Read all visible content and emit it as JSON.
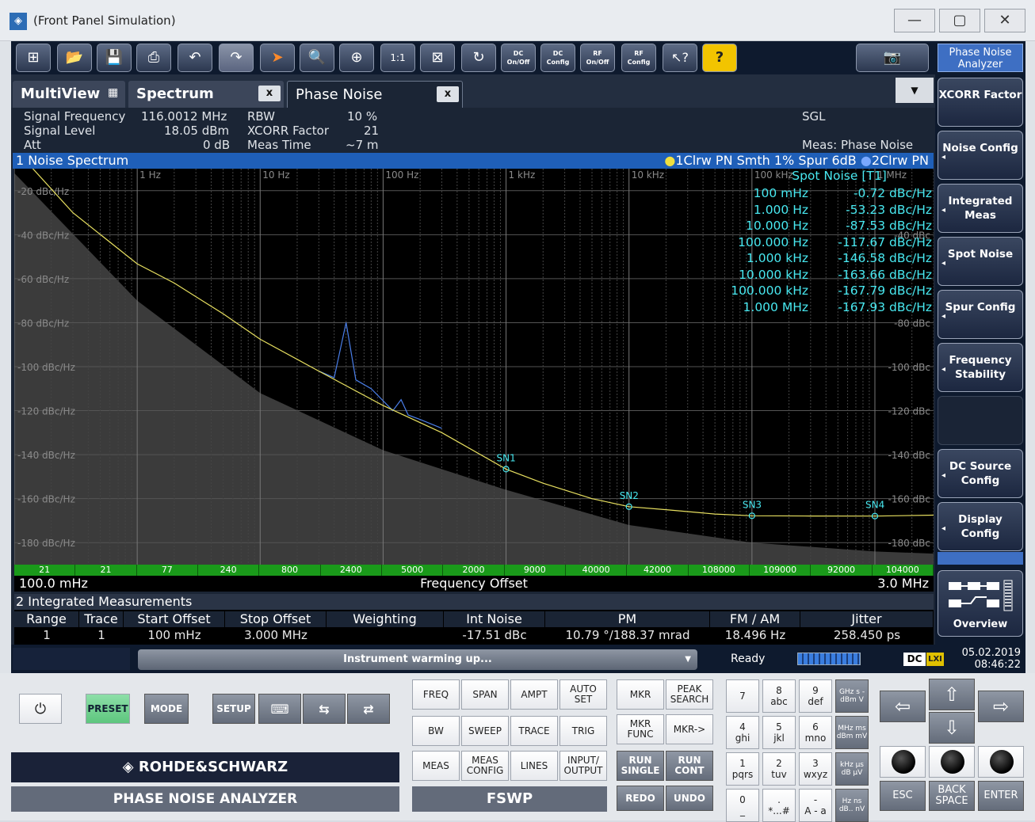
{
  "window": {
    "title": "(Front Panel Simulation)",
    "minimize": "—",
    "maximize": "▢",
    "close": "✕"
  },
  "toolbar": {
    "dc_onoff": "DC On/Off",
    "dc_config": "DC Config",
    "rf_onoff": "RF On/Off",
    "rf_config": "RF Config",
    "help": "?"
  },
  "softkeys": {
    "title": "Phase Noise Analyzer",
    "items": [
      "XCORR Factor",
      "Noise Config",
      "Integrated Meas",
      "Spot Noise",
      "Spur Config",
      "Frequency Stability",
      "",
      "DC Source Config",
      "Display Config"
    ],
    "overview": "Overview"
  },
  "tabs": {
    "multiview": "MultiView",
    "spectrum": "Spectrum",
    "phase_noise": "Phase Noise",
    "close_label": "x",
    "dropdown": "▼"
  },
  "info": {
    "signal_frequency_label": "Signal Frequency",
    "signal_frequency_value": "116.0012 MHz",
    "signal_level_label": "Signal Level",
    "signal_level_value": "18.05 dBm",
    "att_label": "Att",
    "att_value": "0 dB",
    "rbw_label": "RBW",
    "rbw_value": "10 %",
    "xcorr_label": "XCORR Factor",
    "xcorr_value": "21",
    "meas_time_label": "Meas Time",
    "meas_time_value": "~7 m",
    "sgl": "SGL",
    "meas": "Meas: Phase Noise"
  },
  "window1": {
    "title": "1 Noise Spectrum",
    "trace1": "1Clrw PN Smth 1% Spur 6dB",
    "trace2": "2Clrw PN"
  },
  "spot_noise": {
    "title": "Spot Noise [T1]",
    "rows": [
      {
        "freq": "100 mHz",
        "value": "-0.72 dBc/Hz"
      },
      {
        "freq": "1.000 Hz",
        "value": "-53.23 dBc/Hz"
      },
      {
        "freq": "10.000 Hz",
        "value": "-87.53 dBc/Hz"
      },
      {
        "freq": "100.000 Hz",
        "value": "-117.67 dBc/Hz"
      },
      {
        "freq": "1.000 kHz",
        "value": "-146.58 dBc/Hz"
      },
      {
        "freq": "10.000 kHz",
        "value": "-163.66 dBc/Hz"
      },
      {
        "freq": "100.000 kHz",
        "value": "-167.79 dBc/Hz"
      },
      {
        "freq": "1.000 MHz",
        "value": "-167.93 dBc/Hz"
      }
    ]
  },
  "chart_data": {
    "type": "line",
    "x_scale": "log",
    "xlim": [
      0.1,
      3000000
    ],
    "ylim": [
      -190,
      -10
    ],
    "x_ticks": [
      {
        "x": 1,
        "label": "1 Hz"
      },
      {
        "x": 10,
        "label": "10 Hz"
      },
      {
        "x": 100,
        "label": "100 Hz"
      },
      {
        "x": 1000,
        "label": "1 kHz"
      },
      {
        "x": 10000,
        "label": "10 kHz"
      },
      {
        "x": 100000,
        "label": "100 kHz"
      },
      {
        "x": 1000000,
        "label": "1 MHz"
      }
    ],
    "y_ticks_left": [
      {
        "y": -20,
        "label": "-20 dBc/Hz"
      },
      {
        "y": -40,
        "label": "-40 dBc/Hz"
      },
      {
        "y": -60,
        "label": "-60 dBc/Hz"
      },
      {
        "y": -80,
        "label": "-80 dBc/Hz"
      },
      {
        "y": -100,
        "label": "-100 dBc/Hz"
      },
      {
        "y": -120,
        "label": "-120 dBc/Hz"
      },
      {
        "y": -140,
        "label": "-140 dBc/Hz"
      },
      {
        "y": -160,
        "label": "-160 dBc/Hz"
      },
      {
        "y": -180,
        "label": "-180 dBc/Hz"
      }
    ],
    "y_ticks_right": [
      {
        "y": -40,
        "label": "-40 dBc"
      },
      {
        "y": -80,
        "label": "-80 dBc"
      },
      {
        "y": -100,
        "label": "-100 dBc"
      },
      {
        "y": -120,
        "label": "-120 dBc"
      },
      {
        "y": -140,
        "label": "-140 dBc"
      },
      {
        "y": -160,
        "label": "-160 dBc"
      },
      {
        "y": -180,
        "label": "-180 dBc"
      }
    ],
    "series": [
      {
        "name": "1Clrw PN Smth 1% Spur 6dB",
        "color": "#e8e060",
        "x": [
          0.1,
          0.3,
          1,
          2,
          5,
          10,
          30,
          100,
          300,
          1000,
          2000,
          5000,
          10000,
          20000,
          50000,
          100000,
          300000,
          1000000,
          3000000
        ],
        "y": [
          -0.72,
          -30,
          -53.23,
          -62,
          -76,
          -87.53,
          -102,
          -117.67,
          -130,
          -146.58,
          -153,
          -160,
          -163.66,
          -165,
          -167,
          -167.79,
          -167.9,
          -167.93,
          -167.5
        ]
      },
      {
        "name": "2Clrw PN",
        "color": "#4a7ee8",
        "x": [
          30,
          40,
          50,
          60,
          80,
          120,
          140,
          160,
          200,
          300
        ],
        "y": [
          -102,
          -105,
          -80,
          -106,
          -110,
          -120,
          -115,
          -122,
          -124,
          -128
        ]
      }
    ],
    "noise_floor": {
      "color": "#3b3b3b",
      "x": [
        0.1,
        1,
        10,
        100,
        1000,
        10000,
        100000,
        1000000,
        3000000
      ],
      "y": [
        -12,
        -70,
        -112,
        -138,
        -156,
        -172,
        -180,
        -184,
        -185
      ]
    },
    "markers": [
      {
        "label": "SN1",
        "x": 1000,
        "y": -146.58
      },
      {
        "label": "SN2",
        "x": 10000,
        "y": -163.66
      },
      {
        "label": "SN3",
        "x": 100000,
        "y": -167.79
      },
      {
        "label": "SN4",
        "x": 1000000,
        "y": -167.93
      }
    ],
    "xcorr_bar": [
      "21",
      "21",
      "77",
      "240",
      "800",
      "2400",
      "5000",
      "2000",
      "9000",
      "40000",
      "42000",
      "108000",
      "109000",
      "92000",
      "104000"
    ],
    "x_start": "100.0 mHz",
    "x_label": "Frequency Offset",
    "x_stop": "3.0 MHz"
  },
  "window2": {
    "title": "2 Integrated Measurements",
    "headers": [
      "Range",
      "Trace",
      "Start Offset",
      "Stop Offset",
      "Weighting",
      "Int Noise",
      "PM",
      "FM / AM",
      "Jitter"
    ],
    "row": [
      "1",
      "1",
      "100 mHz",
      "3.000 MHz",
      "",
      "-17.51 dBc",
      "10.79 °/188.37 mrad",
      "18.496 Hz",
      "258.450 ps"
    ]
  },
  "status": {
    "message": "Instrument warming up...",
    "ready": "Ready",
    "dc": "DC",
    "lxi": "LXI",
    "date": "05.02.2019",
    "time": "08:46:22"
  },
  "front": {
    "power": "⏻",
    "preset": "PRESET",
    "mode": "MODE",
    "setup": "SETUP",
    "brand": "ROHDE&SCHWARZ",
    "product": "PHASE NOISE ANALYZER",
    "model": "FSWP",
    "keys": [
      [
        "FREQ",
        "SPAN",
        "AMPT",
        "AUTO SET"
      ],
      [
        "BW",
        "SWEEP",
        "TRACE",
        "TRIG"
      ],
      [
        "MEAS",
        "MEAS CONFIG",
        "LINES",
        "INPUT/ OUTPUT"
      ]
    ],
    "mkr_keys": [
      [
        "MKR",
        "PEAK SEARCH"
      ],
      [
        "MKR FUNC",
        "MKR->"
      ],
      [
        "RUN SINGLE",
        "RUN CONT"
      ],
      [
        "REDO",
        "UNDO"
      ]
    ],
    "numpad": [
      [
        "7",
        ""
      ],
      [
        "8",
        "abc"
      ],
      [
        "9",
        "def"
      ],
      [
        "4",
        "ghi"
      ],
      [
        "5",
        "jkl"
      ],
      [
        "6",
        "mno"
      ],
      [
        "1",
        "pqrs"
      ],
      [
        "2",
        "tuv"
      ],
      [
        "3",
        "wxyz"
      ],
      [
        "0",
        "_"
      ],
      [
        ".",
        "*...#"
      ],
      [
        "-",
        "A - a"
      ]
    ],
    "units": [
      "GHz s -dBm V",
      "MHz ms dBm mV",
      "kHz µs dB µV",
      "Hz ns dB.. nV"
    ],
    "esc": "ESC",
    "backspace": "BACK SPACE",
    "enter": "ENTER"
  }
}
